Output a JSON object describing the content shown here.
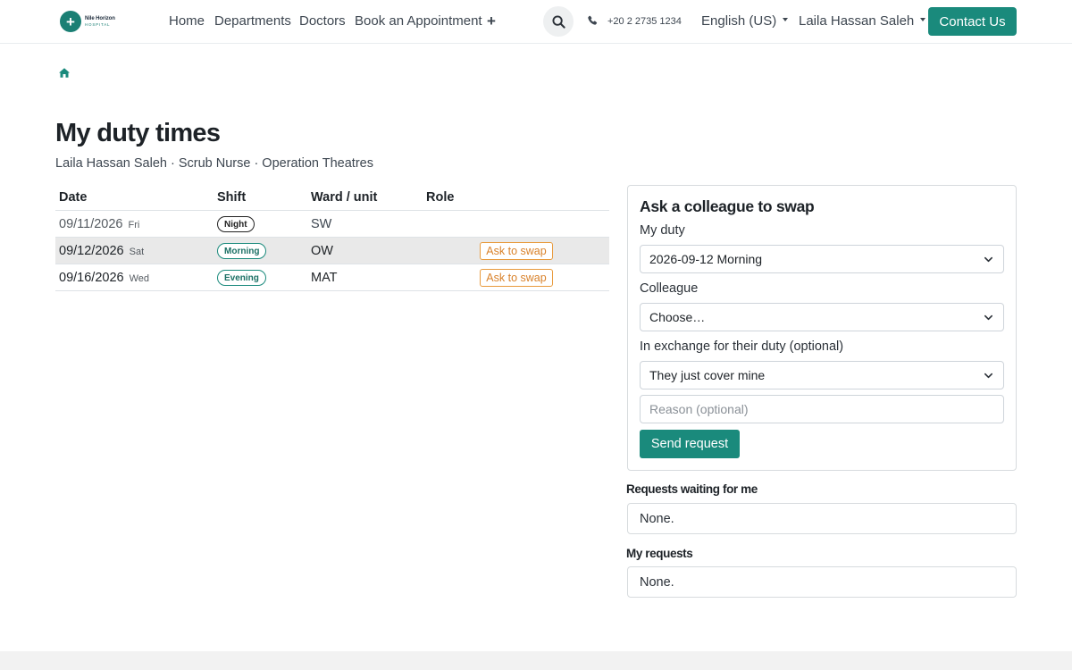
{
  "header": {
    "logo": {
      "name": "Nile Horizon",
      "sub": "HOSPITAL",
      "icon": "plus-cross"
    },
    "nav": [
      {
        "label": "Home"
      },
      {
        "label": "Departments"
      },
      {
        "label": "Doctors"
      },
      {
        "label": "Book an Appointment"
      }
    ],
    "phone": "+20 2 2735 1234",
    "language": "English (US)",
    "user_name": "Laila Hassan Saleh",
    "contact_label": "Contact Us",
    "accent": "#1a8a7c"
  },
  "page": {
    "title": "My duty times",
    "subtitle": "Laila Hassan Saleh · Scrub Nurse · Operation Theatres"
  },
  "duties": {
    "columns": [
      "Date",
      "Shift",
      "Ward / unit",
      "Role"
    ],
    "rows": [
      {
        "date": "09/11/2026",
        "dow": "Fri",
        "shift": "Night",
        "ward": "SW",
        "role": "",
        "action": ""
      },
      {
        "date": "09/12/2026",
        "dow": "Sat",
        "shift": "Morning",
        "ward": "OW",
        "role": "",
        "action": "Ask to swap"
      },
      {
        "date": "09/16/2026",
        "dow": "Wed",
        "shift": "Evening",
        "ward": "MAT",
        "role": "",
        "action": "Ask to swap"
      }
    ]
  },
  "swap_form": {
    "title": "Ask a colleague to swap",
    "my_duty_label": "My duty",
    "my_duty_value": "2026-09-12 Morning",
    "colleague_label": "Colleague",
    "colleague_value": "Choose…",
    "exchange_label": "In exchange for their duty (optional)",
    "exchange_value": "They just cover mine",
    "reason_placeholder": "Reason (optional)",
    "submit_label": "Send request"
  },
  "requests": {
    "waiting_label": "Requests waiting for me",
    "waiting_value": "None.",
    "mine_label": "My requests",
    "mine_value": "None."
  }
}
